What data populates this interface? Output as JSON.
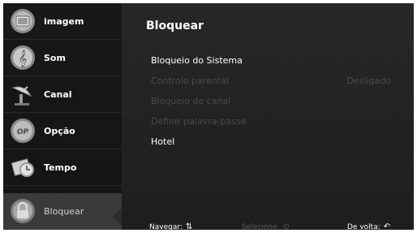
{
  "sidebar": {
    "items": [
      {
        "label": "imagem",
        "icon": "image-icon"
      },
      {
        "label": "Som",
        "icon": "music-note-icon"
      },
      {
        "label": "Canal",
        "icon": "satellite-dish-icon"
      },
      {
        "label": "Opção",
        "icon": "option-icon"
      },
      {
        "label": "Tempo",
        "icon": "clock-icon"
      },
      {
        "label": "Bloquear",
        "icon": "lock-icon",
        "active": true
      }
    ]
  },
  "panel": {
    "title": "Bloquear",
    "options": [
      {
        "label": "Bloqueio do Sistema",
        "enabled": true
      },
      {
        "label": "Controlo parental",
        "value": "Desligado",
        "enabled": false
      },
      {
        "label": "Bloqueio de canal",
        "enabled": false
      },
      {
        "label": "Definir palavra-passe",
        "enabled": false
      },
      {
        "label": "Hotel",
        "enabled": true
      }
    ]
  },
  "footer": {
    "navigate": "Navegar:",
    "select": "Selecione:",
    "back": "De volta:"
  },
  "colors": {
    "background": "#1d1d1d",
    "active_item": "#3a3a3a",
    "disabled_text": "#4b4b4b"
  }
}
